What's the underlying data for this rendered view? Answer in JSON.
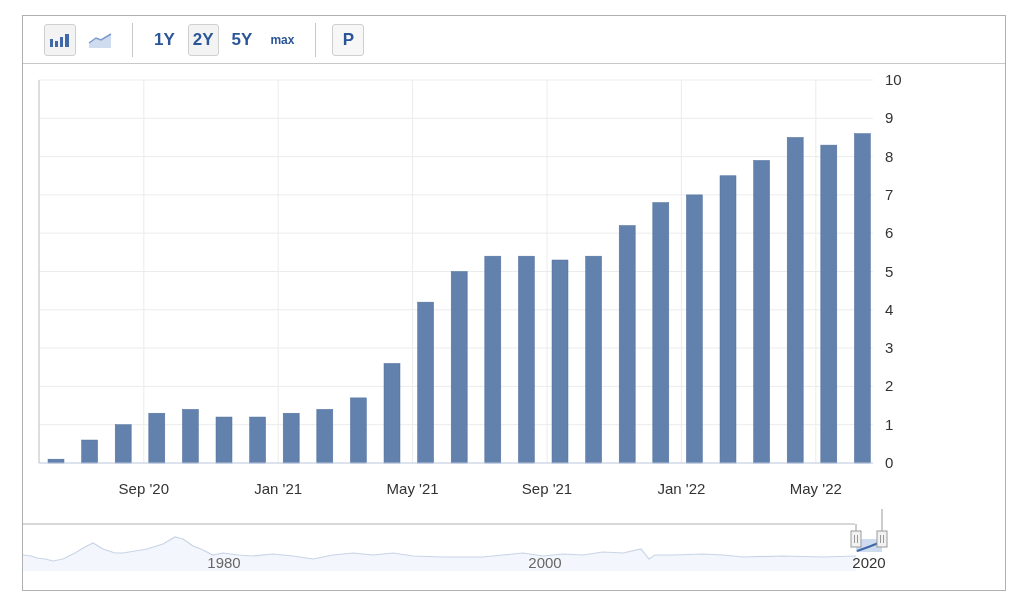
{
  "toolbar": {
    "chart_types": [
      {
        "kind": "bar",
        "selected": true
      },
      {
        "kind": "line",
        "selected": false
      }
    ],
    "ranges": [
      {
        "label": "1Y",
        "selected": false
      },
      {
        "label": "2Y",
        "selected": true
      },
      {
        "label": "5Y",
        "selected": false
      },
      {
        "label": "max",
        "selected": false
      }
    ],
    "extra_button": {
      "label": "P"
    }
  },
  "chart": {
    "chart_data": {
      "type": "bar",
      "categories": [
        null,
        null,
        null,
        "Sep '20",
        null,
        null,
        null,
        "Jan '21",
        null,
        null,
        null,
        "May '21",
        null,
        null,
        null,
        "Sep '21",
        null,
        null,
        null,
        "Jan '22",
        null,
        null,
        null,
        "May '22",
        null
      ],
      "values": [
        0.1,
        0.6,
        1.0,
        1.3,
        1.4,
        1.2,
        1.2,
        1.3,
        1.4,
        1.7,
        2.6,
        4.2,
        5.0,
        5.4,
        5.4,
        5.3,
        5.4,
        6.2,
        6.8,
        7.0,
        7.5,
        7.9,
        8.5,
        8.3,
        8.6
      ],
      "ylim": [
        0,
        10
      ],
      "grid": true,
      "yticks": [
        0,
        1,
        2,
        3,
        4,
        5,
        6,
        7,
        8,
        9,
        10
      ]
    }
  },
  "navigator": {
    "labels": [
      "1980",
      "2000",
      "2020"
    ]
  }
}
